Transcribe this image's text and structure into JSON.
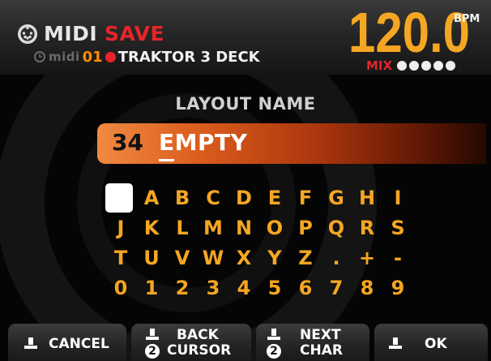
{
  "header": {
    "title_midi": "MIDI",
    "title_save": "SAVE",
    "subtitle_midi": "midi",
    "subtitle_number": "01",
    "subtitle_name": "TRAKTOR 3 DECK",
    "bpm_value": "120.0",
    "bpm_label": "BPM",
    "mix_label": "MIX",
    "mix_dots": 5
  },
  "layout_name": {
    "title": "LAYOUT NAME",
    "number": "34",
    "value": "EMPTY"
  },
  "keyboard": {
    "rows": [
      [
        "",
        "A",
        "B",
        "C",
        "D",
        "E",
        "F",
        "G",
        "H",
        "I"
      ],
      [
        "J",
        "K",
        "L",
        "M",
        "N",
        "O",
        "P",
        "Q",
        "R",
        "S"
      ],
      [
        "T",
        "U",
        "V",
        "W",
        "X",
        "Y",
        "Z",
        ".",
        "+",
        "-"
      ],
      [
        "0",
        "1",
        "2",
        "3",
        "4",
        "5",
        "6",
        "7",
        "8",
        "9"
      ]
    ]
  },
  "footer": {
    "cancel": "CANCEL",
    "back_line1": "BACK",
    "back_line2": "CURSOR",
    "back_num": "2",
    "next_line1": "NEXT",
    "next_line2": "CHAR",
    "next_num": "2",
    "ok": "OK"
  },
  "colors": {
    "accent_orange": "#f5a623",
    "accent_red": "#e8242a",
    "background": "#050505"
  },
  "icons": {
    "logo": "midi-connector-icon",
    "footer_buttons": "button-press-icon"
  }
}
